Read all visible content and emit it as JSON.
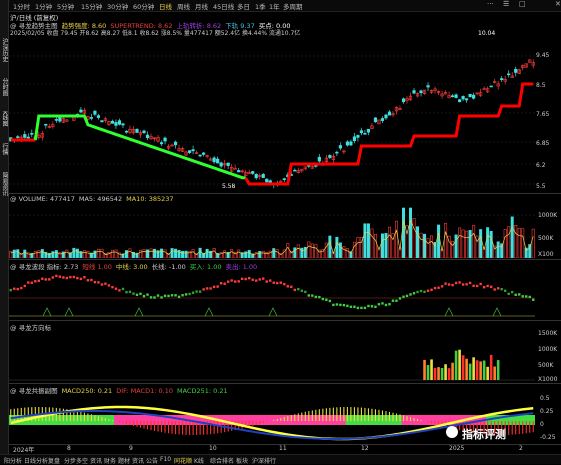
{
  "toolbar": {
    "items": [
      "1分时",
      "1分钟",
      "5分钟",
      "15分钟",
      "30分钟",
      "60分钟",
      "日线",
      "周线",
      "月线",
      "45日线",
      "多日",
      "1季",
      "1年",
      "多周期"
    ],
    "active_index": 6,
    "right_icons": [
      "···",
      "☰",
      "□",
      "✕"
    ]
  },
  "sidebar": {
    "tabs": [
      "沪深历史",
      "分时图",
      "K线图",
      "行情",
      "简易资讯"
    ]
  },
  "main_panel": {
    "line1": "沪/日线 (前复权)",
    "header_items": [
      {
        "text": "@ 寻龙趋势主图",
        "color": "#cccccc"
      },
      {
        "text": "趋势强度: 8.60",
        "color": "#e8d24a"
      },
      {
        "text": "SUPERTREND: 8.62",
        "color": "#e84040"
      },
      {
        "text": "上轨转折: 8.62",
        "color": "#a040e0"
      },
      {
        "text": "下轨 9.37",
        "color": "#40c0e0"
      },
      {
        "text": "买点: 0.00",
        "color": "#ffffff"
      }
    ],
    "line3": "2025/02/05 收盘 79.45 开8.62 高8.27 低8.1 收8.62 涨8.5% 量477417 额52.4亿 换4.44% 流通10.7亿",
    "price_max_label": "10.04",
    "price_min_label": "5.58",
    "y_ticks": [
      "9.45",
      "8.5",
      "7.65",
      "6.85",
      "6.2",
      "5.5"
    ]
  },
  "volume_panel": {
    "header_items": [
      {
        "text": "@ VOLUME: 477417",
        "color": "#cccccc"
      },
      {
        "text": "MA5: 496542",
        "color": "#cccccc"
      },
      {
        "text": "MA10: 385237",
        "color": "#e8d24a"
      }
    ],
    "y_ticks": [
      "1000K",
      "500K",
      "X100"
    ]
  },
  "osc_panel": {
    "header_items": [
      {
        "text": "@ 寻龙波段 指标: 2.73",
        "color": "#cccccc"
      },
      {
        "text": "短线 1.00",
        "color": "#e84040"
      },
      {
        "text": "中线: 3.00",
        "color": "#e8d24a"
      },
      {
        "text": "长线: -1.00",
        "color": "#cccccc"
      },
      {
        "text": "买入: 1.00",
        "color": "#40d040"
      },
      {
        "text": "卖出: 1.00",
        "color": "#a040e0"
      }
    ]
  },
  "dragon_panel": {
    "header_items": [
      {
        "text": "@ 寻龙方向标",
        "color": "#cccccc"
      }
    ],
    "y_ticks": [
      "1500K",
      "1000K",
      "500K",
      "X1000"
    ]
  },
  "macd_panel": {
    "header_items": [
      {
        "text": "@ 寻龙共振副图",
        "color": "#cccccc"
      },
      {
        "text": "MACD250: 0.21",
        "color": "#e8d24a"
      },
      {
        "text": "DIF: MACD1: 0.10",
        "color": "#e84040"
      },
      {
        "text": "MACD251: 0.21",
        "color": "#40d040"
      }
    ],
    "y_ticks": [
      "0.5",
      "0.25",
      "0",
      "-0.25"
    ]
  },
  "time_axis": {
    "labels": [
      "2024年",
      "8",
      "9",
      "10",
      "11",
      "12",
      "2025",
      "2"
    ]
  },
  "watermark": {
    "text": "指标评测"
  },
  "bottom_bar": {
    "items": [
      "阳分析",
      "日线分析",
      "复盘",
      "分步多空",
      "资讯",
      "财务",
      "题材",
      "资讯",
      "公告",
      "F10",
      "同花顺",
      "K线",
      "综合排名",
      "板块",
      "沪深排行"
    ],
    "active_index": 10
  },
  "colors": {
    "up": "#ff3b3b",
    "down": "#40e0e0",
    "trend_up": "#ff0000",
    "trend_down": "#30ff30",
    "ma10": "#e8d24a",
    "grid": "#2c2c2c"
  }
}
